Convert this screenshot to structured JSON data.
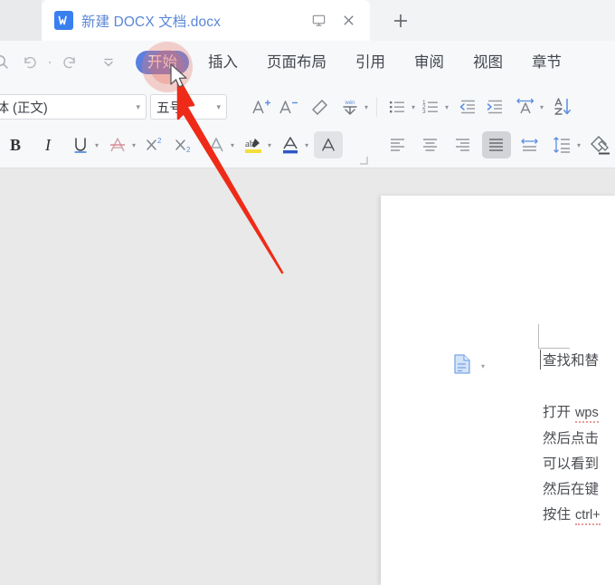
{
  "window": {
    "tab": {
      "title": "新建 DOCX 文档.docx",
      "logo_letter": "W",
      "present_icon": "monitor-icon",
      "close_icon": "close-icon"
    },
    "new_tab_label": "+"
  },
  "quick_access": {
    "items": [
      {
        "name": "search-icon",
        "label": "搜索"
      },
      {
        "name": "undo-icon",
        "label": "撤销"
      },
      {
        "name": "redo-icon",
        "label": "恢复"
      },
      {
        "name": "customize-chevron-icon",
        "label": "自定义快速访问工具栏"
      }
    ]
  },
  "ribbon": {
    "active_tab": "开始",
    "tabs": [
      {
        "label": "开始",
        "active": true
      },
      {
        "label": "插入",
        "active": false
      },
      {
        "label": "页面布局",
        "active": false
      },
      {
        "label": "引用",
        "active": false
      },
      {
        "label": "审阅",
        "active": false
      },
      {
        "label": "视图",
        "active": false
      },
      {
        "label": "章节",
        "active": false
      }
    ],
    "active_color": "#5b7fe0"
  },
  "toolbar": {
    "font_name": "宋体 (正文)",
    "font_size": "五号",
    "caret_glyph": "▾",
    "row1": [
      {
        "name": "grow-font-icon",
        "label": "增大字号"
      },
      {
        "name": "shrink-font-icon",
        "label": "减小字号"
      },
      {
        "name": "clear-format-icon",
        "label": "清除格式"
      },
      {
        "name": "pinyin-guide-icon",
        "label": "拼音指南"
      },
      {
        "name": "bullet-list-icon",
        "label": "项目符号"
      },
      {
        "name": "numbered-list-icon",
        "label": "编号"
      },
      {
        "name": "decrease-indent-icon",
        "label": "减少缩进量"
      },
      {
        "name": "increase-indent-icon",
        "label": "增加缩进量"
      },
      {
        "name": "character-spacing-icon",
        "label": "字符间距"
      },
      {
        "name": "sort-icon",
        "label": "排序"
      }
    ],
    "row2": [
      {
        "name": "bold-icon",
        "label": "加粗",
        "glyph": "B"
      },
      {
        "name": "italic-icon",
        "label": "倾斜",
        "glyph": "I"
      },
      {
        "name": "underline-icon",
        "label": "下划线",
        "glyph": "U"
      },
      {
        "name": "strikethrough-icon",
        "label": "删除线",
        "glyph": "A"
      },
      {
        "name": "superscript-icon",
        "label": "上标",
        "glyph": "X²"
      },
      {
        "name": "subscript-icon",
        "label": "下标",
        "glyph": "X₂"
      },
      {
        "name": "text-effects-icon",
        "label": "文字效果",
        "glyph": "A"
      },
      {
        "name": "highlight-color-icon",
        "label": "突出显示",
        "glyph": "ab"
      },
      {
        "name": "font-color-icon",
        "label": "字体颜色",
        "glyph": "A"
      },
      {
        "name": "text-box-icon",
        "label": "字符边框",
        "glyph": "A"
      },
      {
        "name": "align-left-icon",
        "label": "左对齐"
      },
      {
        "name": "align-center-icon",
        "label": "居中对齐"
      },
      {
        "name": "align-right-icon",
        "label": "右对齐"
      },
      {
        "name": "align-justify-icon",
        "label": "两端对齐",
        "active": true
      },
      {
        "name": "distribute-icon",
        "label": "分散对齐"
      },
      {
        "name": "line-spacing-icon",
        "label": "行距"
      },
      {
        "name": "shading-icon",
        "label": "底纹"
      }
    ],
    "expand_corner": "⌐"
  },
  "document": {
    "paste_options_icon": "paste-options-icon",
    "paste_caret": "▾",
    "lines": [
      {
        "text": "查找和替",
        "is_title": true
      },
      {
        "prefix": "打开 ",
        "spell": "wps",
        "suffix": ""
      },
      {
        "text": "然后点击"
      },
      {
        "text": "可以看到"
      },
      {
        "text": "然后在键"
      },
      {
        "prefix": "按住 ",
        "spell": "ctrl+",
        "suffix": ""
      }
    ]
  },
  "annotation": {
    "highlight_color": "#ea786e",
    "arrow_color": "#ee2b18",
    "cursor": "mouse-pointer"
  }
}
